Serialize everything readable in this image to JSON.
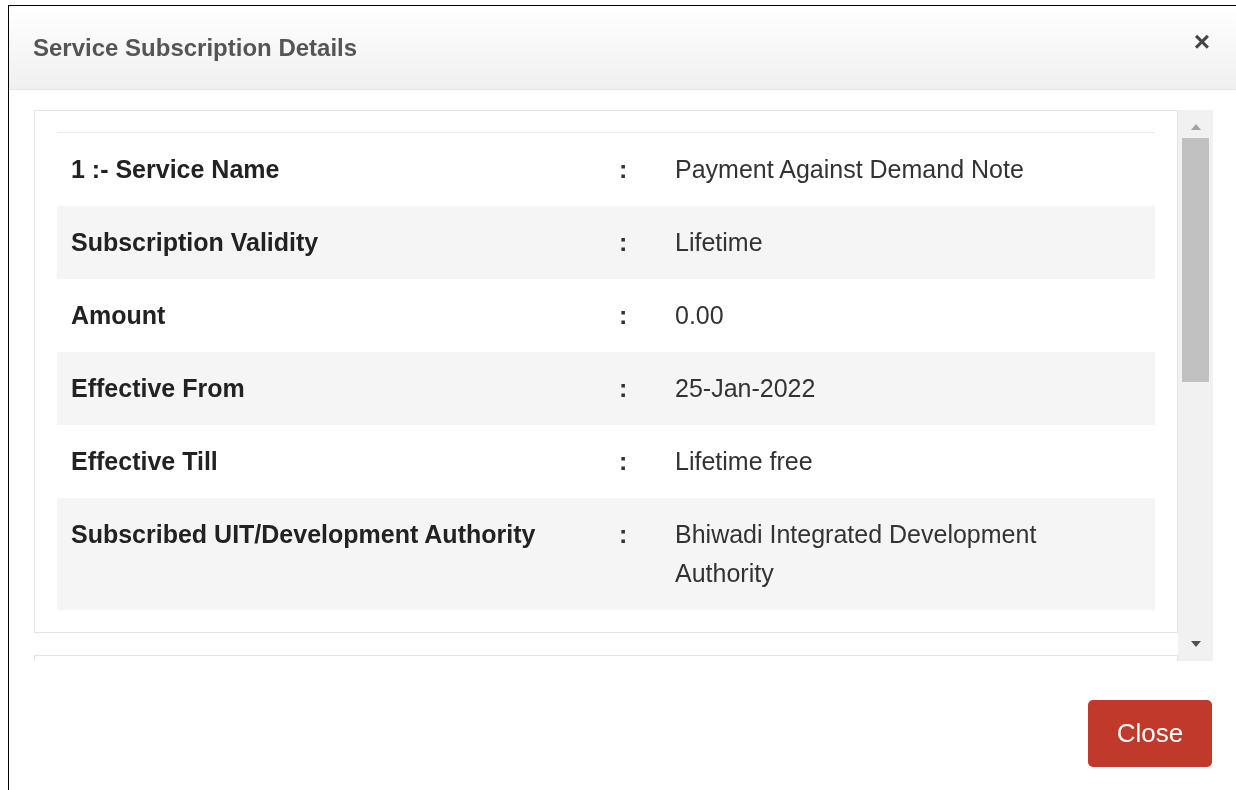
{
  "dialog": {
    "title": "Service Subscription Details",
    "close_icon": "×"
  },
  "details": [
    {
      "label": "1 :- Service Name",
      "separator": ":",
      "value": "Payment Against Demand Note"
    },
    {
      "label": "Subscription Validity",
      "separator": ":",
      "value": "Lifetime"
    },
    {
      "label": "Amount",
      "separator": ":",
      "value": "0.00"
    },
    {
      "label": "Effective From",
      "separator": ":",
      "value": "25-Jan-2022"
    },
    {
      "label": "Effective Till",
      "separator": ":",
      "value": "Lifetime free"
    },
    {
      "label": "Subscribed UIT/Development Authority",
      "separator": ":",
      "value": "Bhiwadi Integrated Development Authority"
    }
  ],
  "buttons": [
    {
      "label": "Close"
    }
  ]
}
